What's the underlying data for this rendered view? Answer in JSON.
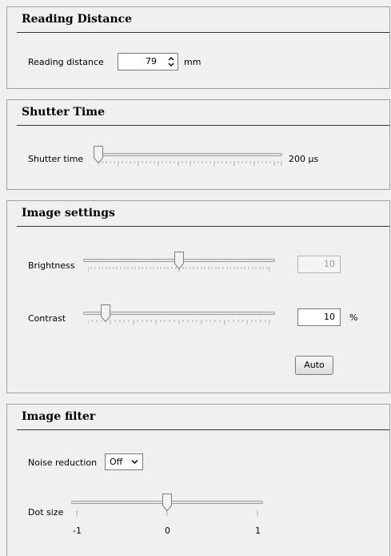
{
  "reading_distance": {
    "title": "Reading Distance",
    "label": "Reading distance",
    "value": "79",
    "unit": "mm"
  },
  "shutter_time": {
    "title": "Shutter Time",
    "label": "Shutter time",
    "value_label": "200 µs",
    "slider_level": 0.0
  },
  "image_settings": {
    "title": "Image settings",
    "brightness": {
      "label": "Brightness",
      "value": "10",
      "slider_level": 0.5
    },
    "contrast": {
      "label": "Contrast",
      "value": "10",
      "unit": "%",
      "slider_level": 0.1
    },
    "auto_label": "Auto"
  },
  "image_filter": {
    "title": "Image filter",
    "noise_reduction": {
      "label": "Noise reduction",
      "value": "Off"
    },
    "dot_size": {
      "label": "Dot size",
      "ticks": [
        "-1",
        "0",
        "1"
      ],
      "value": 0
    }
  }
}
